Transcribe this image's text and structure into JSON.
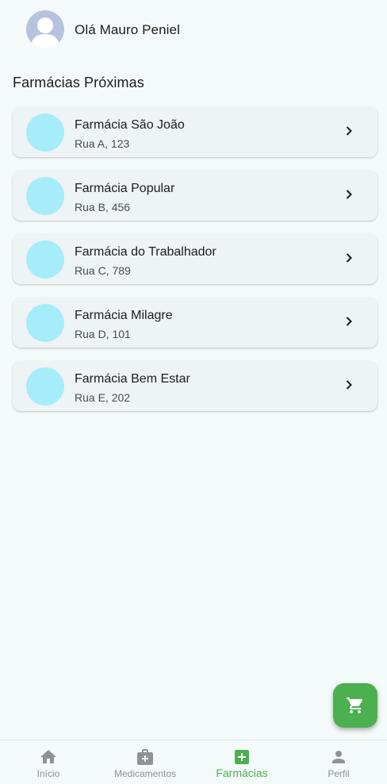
{
  "header": {
    "greeting": "Olá Mauro Peniel"
  },
  "section": {
    "title": "Farmácias Próximas"
  },
  "pharmacies": [
    {
      "name": "Farmácia São João",
      "address": "Rua A, 123"
    },
    {
      "name": "Farmácia Popular",
      "address": "Rua B, 456"
    },
    {
      "name": "Farmácia do Trabalhador",
      "address": "Rua C, 789"
    },
    {
      "name": "Farmácia Milagre",
      "address": "Rua D, 101"
    },
    {
      "name": "Farmácia Bem Estar",
      "address": "Rua E, 202"
    }
  ],
  "fab": {
    "icon": "cart-icon"
  },
  "nav": {
    "items": [
      {
        "label": "Início",
        "icon": "home-icon",
        "active": false
      },
      {
        "label": "Medicamentos",
        "icon": "medical-bag-icon",
        "active": false
      },
      {
        "label": "Farmácias",
        "icon": "pharmacy-cross-icon",
        "active": true
      },
      {
        "label": "Perfil",
        "icon": "person-icon",
        "active": false
      }
    ]
  },
  "colors": {
    "accent": "#4caf50",
    "background": "#f4f9f9",
    "card": "#eef3f5",
    "pharmacy_logo": "#a6ecfa",
    "avatar": "#b5c3df",
    "inactive_nav": "#8f9295"
  }
}
